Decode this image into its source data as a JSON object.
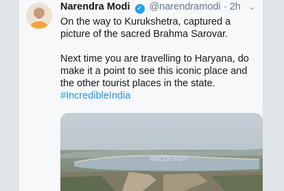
{
  "tweet": {
    "author_name": "Narendra Modi",
    "handle": "@narendramodi",
    "separator": "·",
    "time": "2h",
    "paragraph1": "On the way to Kurukshetra, captured a picture of the sacred Brahma Sarovar.",
    "paragraph2": "Next time you are travelling to Haryana, do make it a point to see this iconic place and the other tourist places in the state.",
    "hashtag": "#IncredibleIndia",
    "watermark": "ABCDEFGH"
  },
  "colors": {
    "link": "#1b95e0",
    "verified": "#1da1f2"
  },
  "icons": {
    "verified": "verified-badge-icon",
    "more": "chevron-down-icon"
  }
}
